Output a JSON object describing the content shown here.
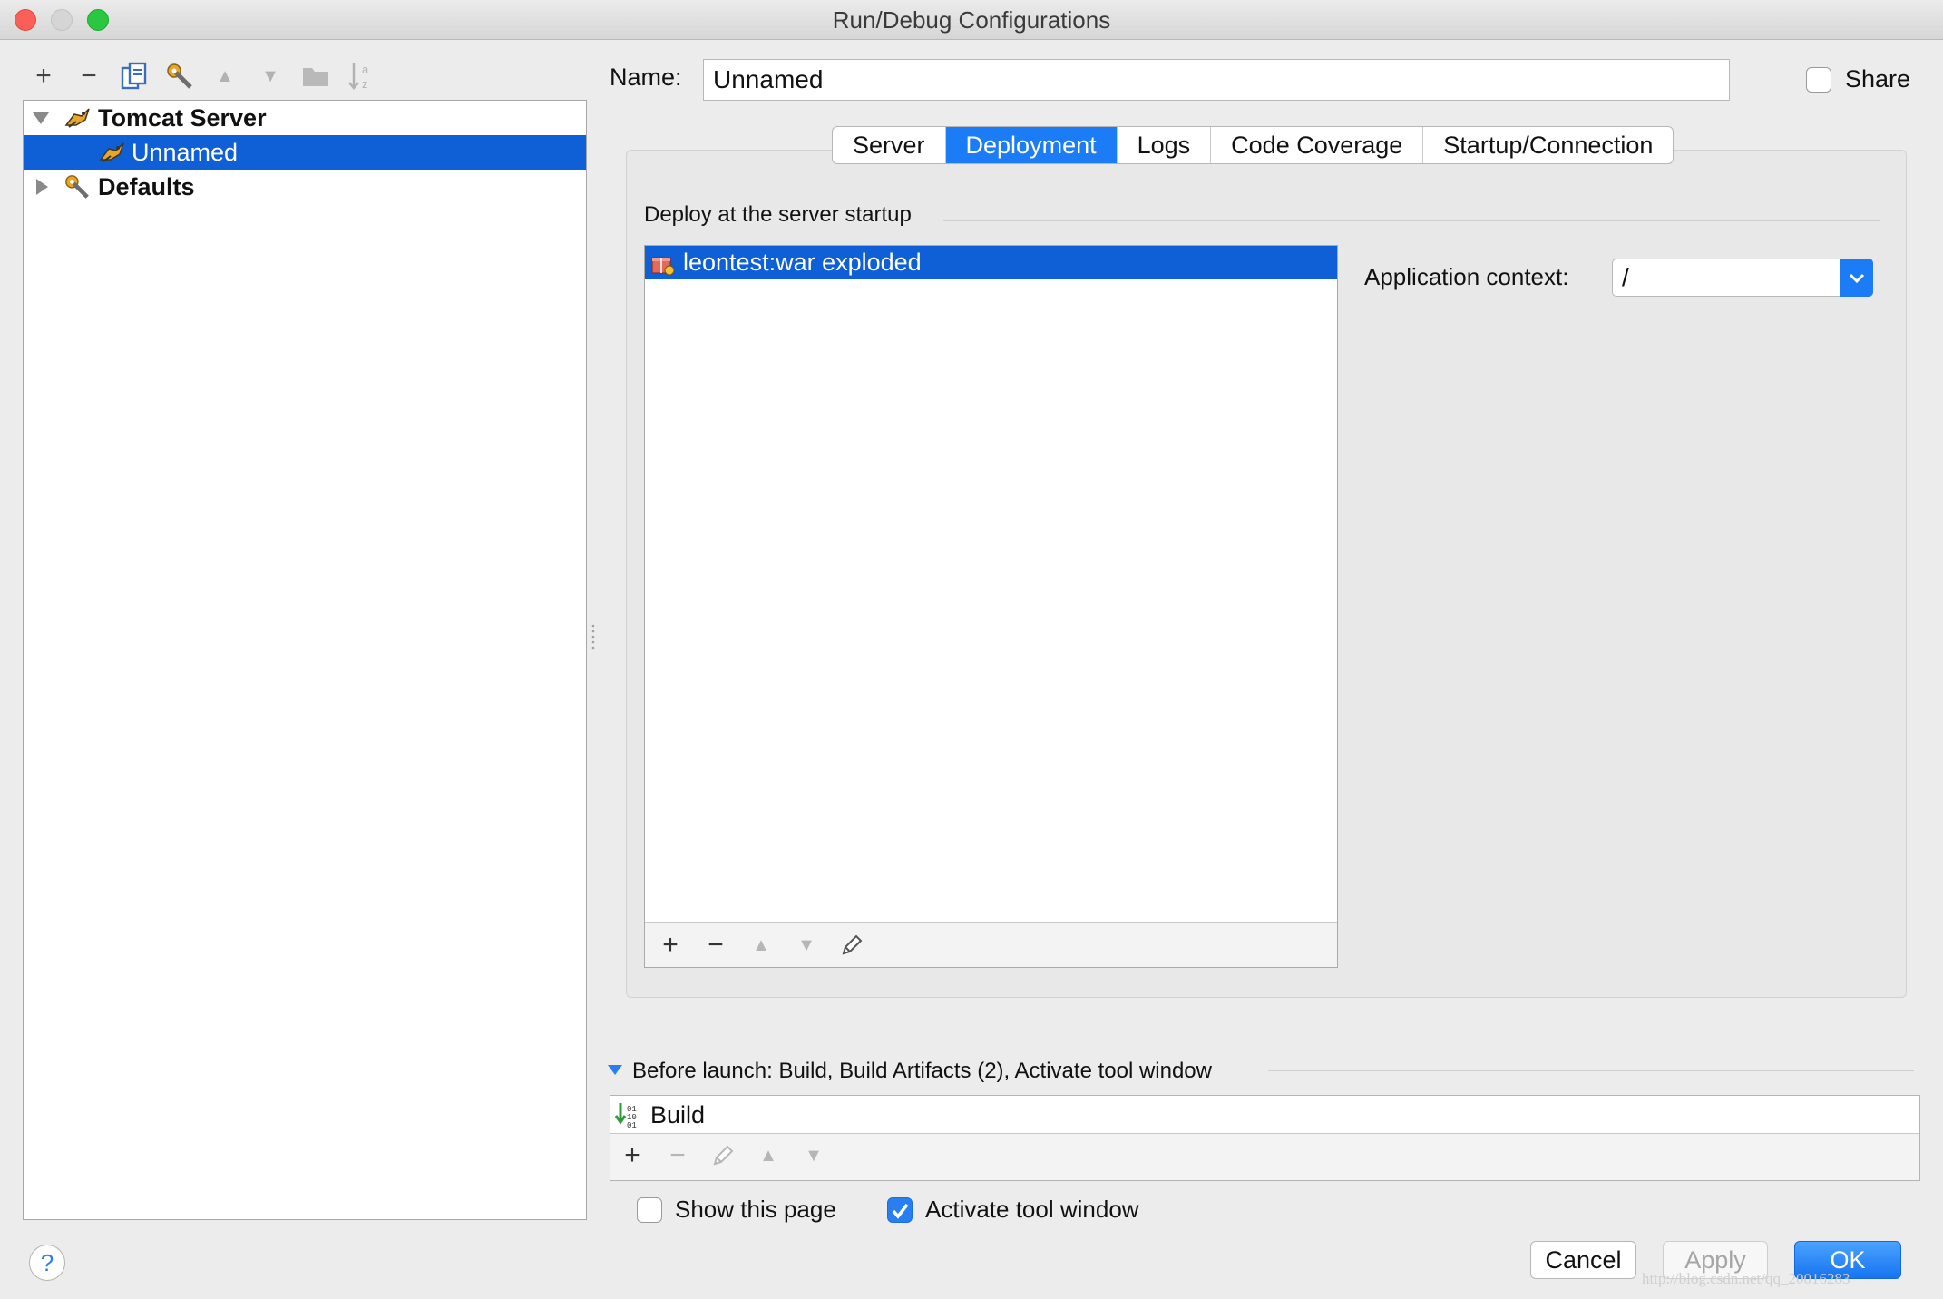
{
  "window": {
    "title": "Run/Debug Configurations",
    "traffic_lights": {
      "close": "#fc5f57",
      "minimize": "#d5d5d5",
      "zoom": "#29c840"
    }
  },
  "toolbar": {
    "add_icon": "+",
    "remove_icon": "−",
    "copy_icon": "copy-icon",
    "wrench_icon": "wrench-icon",
    "move_up_icon": "▲",
    "move_down_icon": "▼",
    "folder_icon": "folder-icon",
    "sort_icon": "sort-az-icon"
  },
  "tree": {
    "items": [
      {
        "label": "Tomcat Server",
        "expanded": true
      },
      {
        "label": "Unnamed",
        "selected": true
      },
      {
        "label": "Defaults",
        "expanded": false
      }
    ]
  },
  "name": {
    "label": "Name:",
    "value": "Unnamed"
  },
  "share": {
    "label": "Share",
    "checked": false
  },
  "tabs": [
    {
      "label": "Server"
    },
    {
      "label": "Deployment",
      "active": true
    },
    {
      "label": "Logs"
    },
    {
      "label": "Code Coverage"
    },
    {
      "label": "Startup/Connection"
    }
  ],
  "deployment": {
    "header": "Deploy at the server startup",
    "items": [
      {
        "label": "leontest:war exploded",
        "selected": true
      }
    ],
    "app_context": {
      "label": "Application context:",
      "value": "/"
    }
  },
  "before_launch": {
    "label": "Before launch: Build, Build Artifacts (2), Activate tool window",
    "items": [
      {
        "label": "Build"
      }
    ]
  },
  "options": {
    "show_page": {
      "label": "Show this page",
      "checked": false
    },
    "activate_tool_window": {
      "label": "Activate tool window",
      "checked": true
    }
  },
  "buttons": {
    "help": "?",
    "cancel": "Cancel",
    "apply": "Apply",
    "ok": "OK"
  },
  "colors": {
    "selection": "#0f5fd6",
    "accent": "#1b7cf5"
  },
  "watermark": "http://blog.csdn.net/qq_20016283"
}
